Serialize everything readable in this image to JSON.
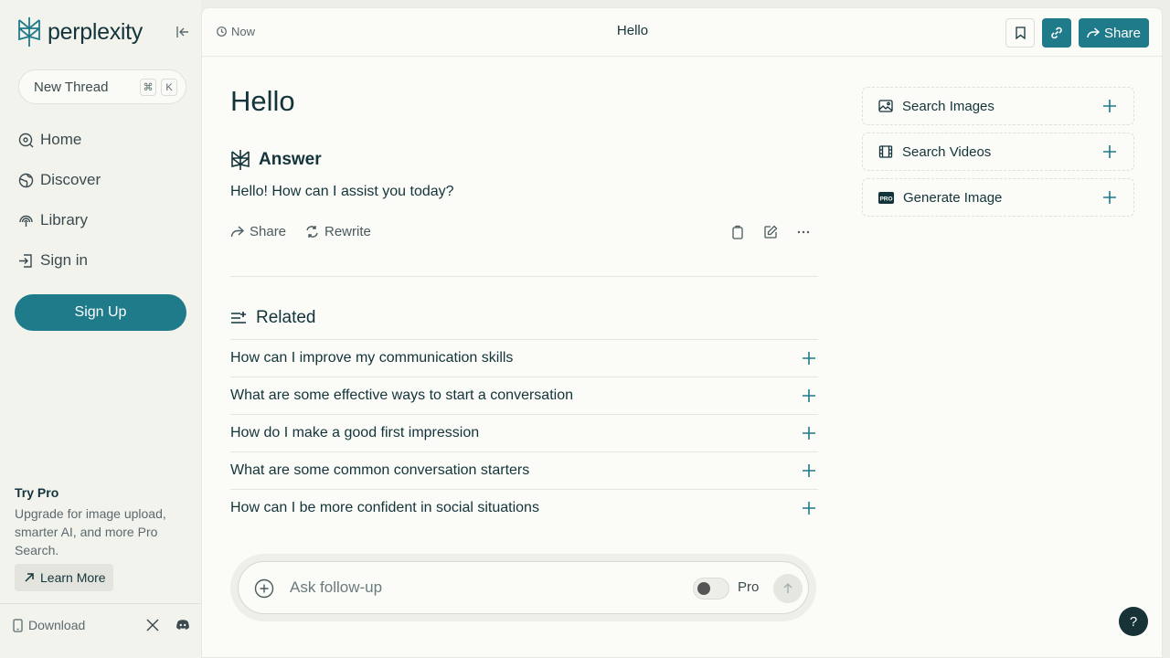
{
  "app": {
    "name": "perplexity"
  },
  "sidebar": {
    "new_thread": {
      "label": "New Thread",
      "shortcut_keys": [
        "⌘",
        "K"
      ]
    },
    "nav": [
      {
        "label": "Home",
        "icon": "home-search-icon"
      },
      {
        "label": "Discover",
        "icon": "globe-icon"
      },
      {
        "label": "Library",
        "icon": "library-icon"
      },
      {
        "label": "Sign in",
        "icon": "sign-in-icon"
      }
    ],
    "signup_label": "Sign Up",
    "try_pro": {
      "title": "Try Pro",
      "description": "Upgrade for image upload, smarter AI, and more Pro Search.",
      "learn_more": "Learn More"
    },
    "footer": {
      "download": "Download"
    }
  },
  "topbar": {
    "time": "Now",
    "title": "Hello",
    "share_label": "Share"
  },
  "thread": {
    "query": "Hello",
    "answer_heading": "Answer",
    "answer_text": "Hello! How can I assist you today?",
    "actions": {
      "share": "Share",
      "rewrite": "Rewrite"
    }
  },
  "related": {
    "heading": "Related",
    "items": [
      "How can I improve my communication skills",
      "What are some effective ways to start a conversation",
      "How do I make a good first impression",
      "What are some common conversation starters",
      "How can I be more confident in social situations"
    ]
  },
  "followup": {
    "placeholder": "Ask follow-up",
    "pro_label": "Pro",
    "pro_enabled": false
  },
  "right_panel": [
    {
      "label": "Search Images",
      "icon": "image-icon"
    },
    {
      "label": "Search Videos",
      "icon": "video-icon"
    },
    {
      "label": "Generate Image",
      "icon": "pro-badge-icon"
    }
  ],
  "help_label": "?",
  "colors": {
    "accent": "#1f7a8a",
    "text": "#13343b",
    "background": "#fbfbf7",
    "sidebar": "#f3f3ee"
  }
}
